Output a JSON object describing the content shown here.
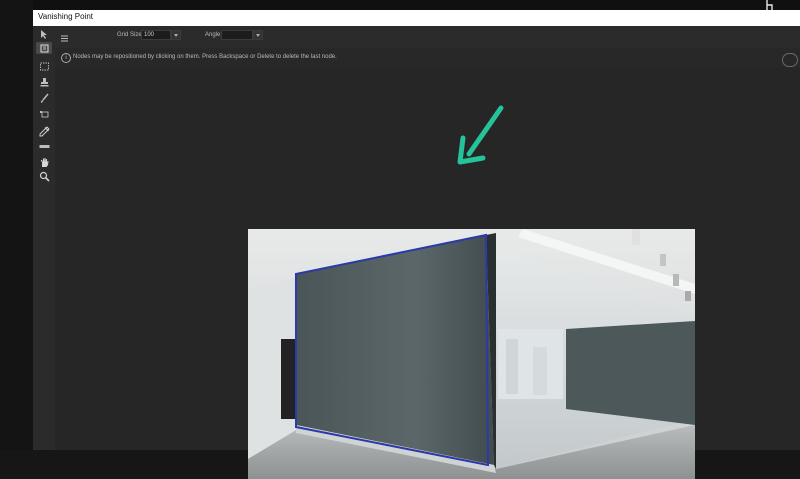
{
  "window": {
    "title": "Vanishing Point"
  },
  "options": {
    "grid_size_label": "Grid Size:",
    "grid_size_value": "100",
    "angle_label": "Angle:",
    "angle_value": ""
  },
  "info": {
    "message": "Nodes may be repositioned by clicking on them.  Press Backspace or Delete to delete the last node."
  },
  "tools": [
    {
      "name": "edit-plane-tool-icon"
    },
    {
      "name": "create-plane-tool-icon"
    },
    {
      "name": "marquee-tool-icon"
    },
    {
      "name": "stamp-tool-icon"
    },
    {
      "name": "brush-tool-icon"
    },
    {
      "name": "transform-tool-icon"
    },
    {
      "name": "eyedropper-tool-icon"
    },
    {
      "name": "measure-tool-icon"
    },
    {
      "name": "hand-tool-icon"
    },
    {
      "name": "zoom-tool-icon"
    }
  ],
  "colors": {
    "plane_outline": "#2a3aa8",
    "annotation_arrow": "#25c39a",
    "canvas_bg": "#262626"
  }
}
